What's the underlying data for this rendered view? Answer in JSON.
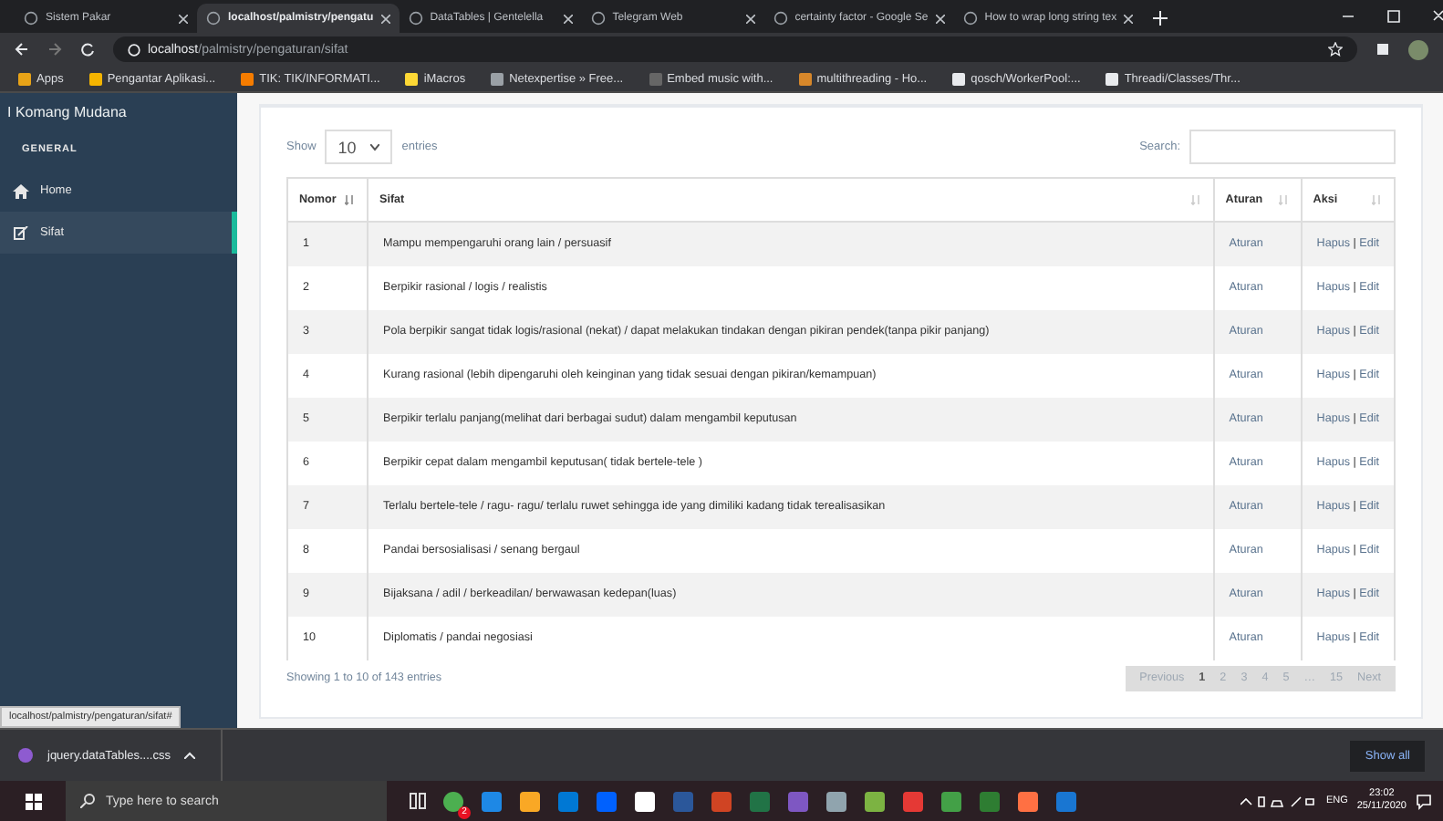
{
  "browser": {
    "tabs": [
      {
        "title": "Sistem Pakar",
        "selected": false
      },
      {
        "title": "localhost/palmistry/pengatu",
        "selected": true
      },
      {
        "title": "DataTables | Gentelella",
        "selected": false
      },
      {
        "title": "Telegram Web",
        "selected": false
      },
      {
        "title": "certainty factor - Google Se",
        "selected": false
      },
      {
        "title": "How to wrap long string tex",
        "selected": false
      }
    ],
    "address": {
      "host": "localhost",
      "path": "/palmistry/pengaturan/sifat"
    },
    "bookmarks": [
      "Apps",
      "Pengantar Aplikasi...",
      "TIK: TIK/INFORMATI...",
      "iMacros",
      "Netexpertise » Free...",
      "Embed music with...",
      "multithreading - Ho...",
      "qosch/WorkerPool:...",
      "Threadi/Classes/Thr..."
    ]
  },
  "sidebar": {
    "user": "I Komang Mudana",
    "section": "GENERAL",
    "items": [
      {
        "label": "Home",
        "selected": false
      },
      {
        "label": "Sifat",
        "selected": true
      }
    ]
  },
  "table_controls": {
    "show": "Show",
    "length": "10",
    "entries": "entries",
    "search": "Search:"
  },
  "table": {
    "columns": [
      {
        "label": "Nomor",
        "sorted": true
      },
      {
        "label": "Sifat",
        "sorted": false
      },
      {
        "label": "Aturan",
        "sorted": false
      },
      {
        "label": "Aksi",
        "sorted": false
      }
    ],
    "rows": [
      [
        "1",
        "Mampu mempengaruhi orang lain / persuasif",
        "Aturan",
        "Hapus",
        "|",
        "Edit"
      ],
      [
        "2",
        "Berpikir rasional / logis / realistis",
        "Aturan",
        "Hapus",
        "|",
        "Edit"
      ],
      [
        "3",
        "Pola berpikir sangat tidak logis/rasional (nekat) / dapat melakukan tindakan dengan pikiran pendek(tanpa pikir panjang)",
        "Aturan",
        "Hapus",
        "|",
        "Edit"
      ],
      [
        "4",
        "Kurang rasional (lebih dipengaruhi oleh keinginan yang tidak sesuai dengan pikiran/kemampuan)",
        "Aturan",
        "Hapus",
        "|",
        "Edit"
      ],
      [
        "5",
        "Berpikir terlalu panjang(melihat dari berbagai sudut) dalam mengambil keputusan",
        "Aturan",
        "Hapus",
        "|",
        "Edit"
      ],
      [
        "6",
        "Berpikir cepat dalam mengambil keputusan( tidak bertele-tele )",
        "Aturan",
        "Hapus",
        "|",
        "Edit"
      ],
      [
        "7",
        "Terlalu bertele-tele / ragu- ragu/ terlalu ruwet sehingga ide yang dimiliki kadang tidak terealisasikan",
        "Aturan",
        "Hapus",
        "|",
        "Edit"
      ],
      [
        "8",
        "Pandai bersosialisasi / senang bergaul",
        "Aturan",
        "Hapus",
        "|",
        "Edit"
      ],
      [
        "9",
        "Bijaksana / adil / berkeadilan/ berwawasan kedepan(luas)",
        "Aturan",
        "Hapus",
        "|",
        "Edit"
      ],
      [
        "10",
        "Diplomatis / pandai negosiasi",
        "Aturan",
        "Hapus",
        "|",
        "Edit"
      ]
    ]
  },
  "info": "Showing 1 to 10 of 143 entries",
  "pagination": [
    {
      "label": "Previous",
      "selected": false
    },
    {
      "label": "1",
      "selected": true
    },
    {
      "label": "2",
      "selected": false
    },
    {
      "label": "3",
      "selected": false
    },
    {
      "label": "4",
      "selected": false
    },
    {
      "label": "5",
      "selected": false
    },
    {
      "label": "…",
      "selected": false
    },
    {
      "label": "15",
      "selected": false
    },
    {
      "label": "Next",
      "selected": false
    }
  ],
  "status_url": "localhost/palmistry/pengaturan/sifat#",
  "download_bar": {
    "file": "jquery.dataTables....css",
    "show_all": "Show all"
  },
  "taskbar": {
    "search": "Type here to search",
    "badge": "2",
    "lang": "ENG",
    "time": "23:02",
    "date": "25/11/2020"
  }
}
